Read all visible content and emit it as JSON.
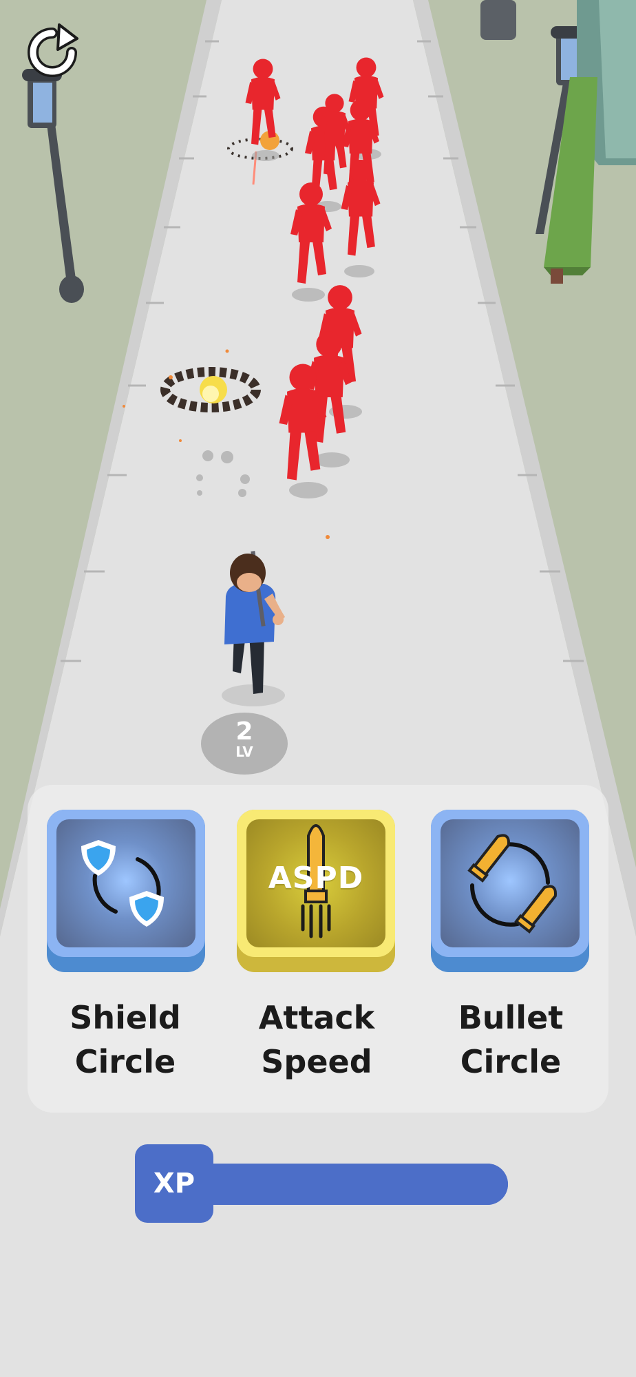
{
  "hud": {
    "restart_icon": "restart-arrow-icon",
    "level": {
      "value": "2",
      "label": "LV"
    }
  },
  "upgrades": [
    {
      "title_line1": "Shield",
      "title_line2": "Circle",
      "icon": "shield-circle-icon"
    },
    {
      "title_line1": "Attack",
      "title_line2": "Speed",
      "icon": "rocket-bullet-icon",
      "icon_text": "ASPD"
    },
    {
      "title_line1": "Bullet",
      "title_line2": "Circle",
      "icon": "bullet-circle-icon"
    }
  ],
  "xp": {
    "label": "XP",
    "progress": 1.0
  },
  "colors": {
    "enemy_red": "#e8262d",
    "player_shirt": "#3f6fd1",
    "card_blue": "#8cb4f3",
    "card_gold": "#f8ea74",
    "xp_blue": "#4c6ec8"
  }
}
